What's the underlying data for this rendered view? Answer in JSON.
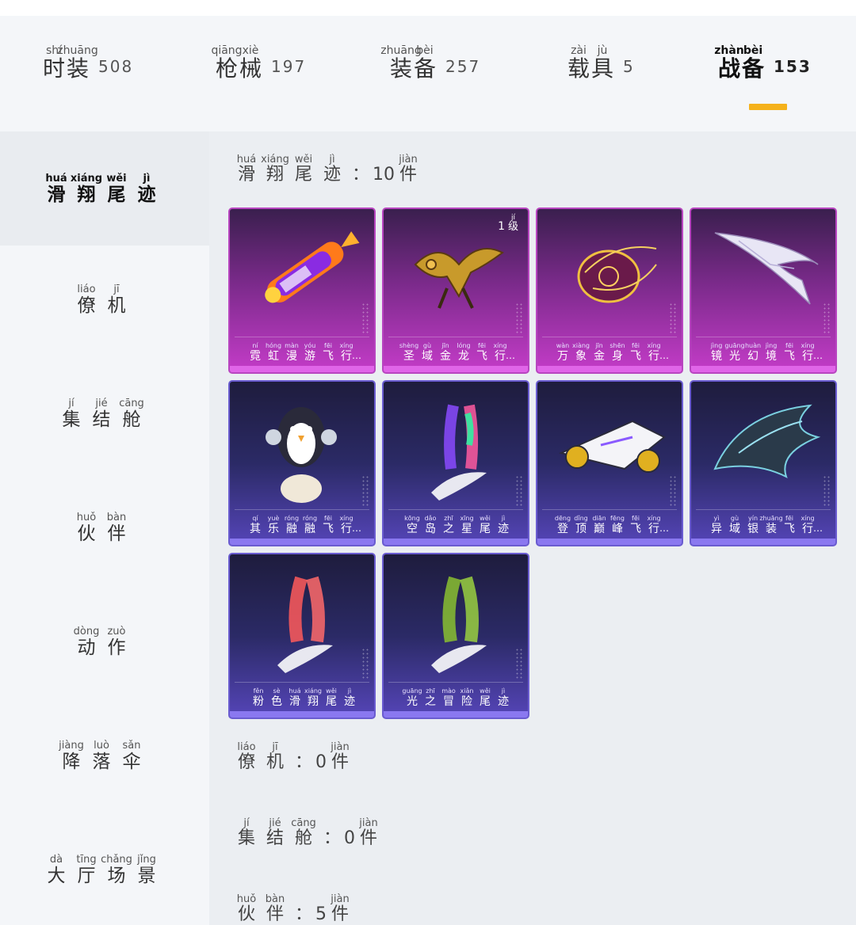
{
  "tabs": [
    {
      "py": [
        "shí",
        "zhuāng"
      ],
      "hz": [
        "时",
        "装"
      ],
      "count": "508",
      "active": false
    },
    {
      "py": [
        "qiāng",
        "xiè"
      ],
      "hz": [
        "枪",
        "械"
      ],
      "count": "197",
      "active": false
    },
    {
      "py": [
        "zhuāng",
        "bèi"
      ],
      "hz": [
        "装",
        "备"
      ],
      "count": "257",
      "active": false
    },
    {
      "py": [
        "zài",
        "jù"
      ],
      "hz": [
        "载",
        "具"
      ],
      "count": "5",
      "active": false
    },
    {
      "py": [
        "zhàn",
        "bèi"
      ],
      "hz": [
        "战",
        "备"
      ],
      "count": "153",
      "active": true
    }
  ],
  "sidebar": [
    {
      "py": [
        "huá",
        "xiáng",
        "wěi",
        "jì"
      ],
      "hz": [
        "滑",
        "翔",
        "尾",
        "迹"
      ],
      "active": true
    },
    {
      "py": [
        "liáo",
        "jī"
      ],
      "hz": [
        "僚",
        "机"
      ]
    },
    {
      "py": [
        "jí",
        "jié",
        "cāng"
      ],
      "hz": [
        "集",
        "结",
        "舱"
      ]
    },
    {
      "py": [
        "huǒ",
        "bàn"
      ],
      "hz": [
        "伙",
        "伴"
      ]
    },
    {
      "py": [
        "dòng",
        "zuò"
      ],
      "hz": [
        "动",
        "作"
      ]
    },
    {
      "py": [
        "jiàng",
        "luò",
        "sǎn"
      ],
      "hz": [
        "降",
        "落",
        "伞"
      ]
    },
    {
      "py": [
        "dà",
        "tīng",
        "chǎng",
        "jǐng"
      ],
      "hz": [
        "大",
        "厅",
        "场",
        "景"
      ]
    }
  ],
  "sections": [
    {
      "py": [
        "huá",
        "xiáng",
        "wěi",
        "jì"
      ],
      "hz": [
        "滑",
        "翔",
        "尾",
        "迹"
      ],
      "count": "10",
      "unit_py": "jiàn",
      "unit": "件"
    },
    {
      "py": [
        "liáo",
        "jī"
      ],
      "hz": [
        "僚",
        "机"
      ],
      "count": "0",
      "unit_py": "jiàn",
      "unit": "件"
    },
    {
      "py": [
        "jí",
        "jié",
        "cāng"
      ],
      "hz": [
        "集",
        "结",
        "舱"
      ],
      "count": "0",
      "unit_py": "jiàn",
      "unit": "件"
    },
    {
      "py": [
        "huǒ",
        "bàn"
      ],
      "hz": [
        "伙",
        "伴"
      ],
      "count": "5",
      "unit_py": "jiàn",
      "unit": "件"
    }
  ],
  "colon": "：",
  "ellipsis": "…",
  "cards": [
    {
      "theme": "purple",
      "art": "rocket-icon",
      "py": [
        "ní",
        "hóng",
        "màn",
        "yóu",
        "fēi",
        "xíng"
      ],
      "hz": [
        "霓",
        "虹",
        "漫",
        "游",
        "飞",
        "行"
      ],
      "truncated": true
    },
    {
      "theme": "purple",
      "art": "dragon-icon",
      "py": [
        "shèng",
        "gù",
        "jīn",
        "lóng",
        "fēi",
        "xíng"
      ],
      "hz": [
        "圣",
        "域",
        "金",
        "龙",
        "飞",
        "行"
      ],
      "truncated": true,
      "level": {
        "n": "1",
        "py": "jí",
        "hz": "级"
      }
    },
    {
      "theme": "purple",
      "art": "golden-orb-icon",
      "py": [
        "wàn",
        "xiàng",
        "jīn",
        "shēn",
        "fēi",
        "xíng"
      ],
      "hz": [
        "万",
        "象",
        "金",
        "身",
        "飞",
        "行"
      ],
      "truncated": true
    },
    {
      "theme": "purple",
      "art": "wing-icon",
      "py": [
        "jìng",
        "guāng",
        "huàn",
        "jìng",
        "fēi",
        "xíng"
      ],
      "hz": [
        "镜",
        "光",
        "幻",
        "境",
        "飞",
        "行"
      ],
      "truncated": true
    },
    {
      "theme": "blue",
      "art": "penguin-icon",
      "py": [
        "qí",
        "yuè",
        "róng",
        "róng",
        "fēi",
        "xíng"
      ],
      "hz": [
        "其",
        "乐",
        "融",
        "融",
        "飞",
        "行"
      ],
      "truncated": true
    },
    {
      "theme": "blue",
      "art": "rainbow-smoke-icon",
      "py": [
        "kōng",
        "dǎo",
        "zhī",
        "xīng",
        "wěi",
        "jì"
      ],
      "hz": [
        "空",
        "岛",
        "之",
        "星",
        "尾",
        "迹"
      ],
      "truncated": false
    },
    {
      "theme": "blue",
      "art": "jet-icon",
      "py": [
        "dēng",
        "dǐng",
        "diān",
        "fēng",
        "fēi",
        "xíng"
      ],
      "hz": [
        "登",
        "顶",
        "巅",
        "峰",
        "飞",
        "行"
      ],
      "truncated": true
    },
    {
      "theme": "blue",
      "art": "dark-wing-icon",
      "py": [
        "yì",
        "gù",
        "yín",
        "zhuāng",
        "fēi",
        "xíng"
      ],
      "hz": [
        "异",
        "域",
        "银",
        "装",
        "飞",
        "行"
      ],
      "truncated": true
    },
    {
      "theme": "blue",
      "art": "pink-smoke-icon",
      "py": [
        "fěn",
        "sè",
        "huá",
        "xiáng",
        "wěi",
        "jì"
      ],
      "hz": [
        "粉",
        "色",
        "滑",
        "翔",
        "尾",
        "迹"
      ],
      "truncated": false
    },
    {
      "theme": "blue",
      "art": "green-smoke-icon",
      "py": [
        "guāng",
        "zhī",
        "mào",
        "xiǎn",
        "wěi",
        "jì"
      ],
      "hz": [
        "光",
        "之",
        "冒",
        "险",
        "尾",
        "迹"
      ],
      "truncated": false
    }
  ],
  "colors": {
    "accent": "#f5b21b",
    "purple_card": "#c43cc8",
    "blue_card": "#5545b8"
  }
}
